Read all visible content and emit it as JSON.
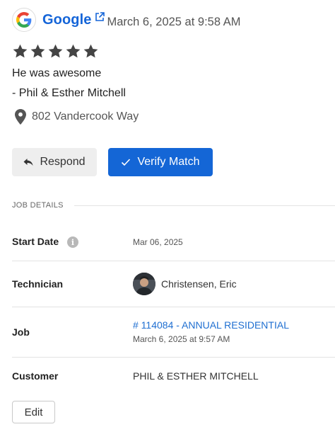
{
  "review": {
    "source": "Google",
    "source_icon": "google-g-logo",
    "date": "March 6, 2025 at 9:58 AM",
    "rating": 5,
    "text": "He was awesome",
    "reviewer": "- Phil & Esther Mitchell",
    "address": "802 Vandercook Way"
  },
  "actions": {
    "respond_label": "Respond",
    "verify_label": "Verify Match"
  },
  "job_details": {
    "section_label": "JOB DETAILS",
    "start_date": {
      "label": "Start Date",
      "value": "Mar 06, 2025"
    },
    "technician": {
      "label": "Technician",
      "value": "Christensen, Eric"
    },
    "job": {
      "label": "Job",
      "link": "# 114084 - ANNUAL RESIDENTIAL",
      "date": "March 6, 2025 at 9:57 AM"
    },
    "customer": {
      "label": "Customer",
      "value": "PHIL & ESTHER MITCHELL"
    },
    "edit_label": "Edit"
  },
  "colors": {
    "brand_blue": "#1466d6",
    "link_blue": "#1f6fd1",
    "star_gray": "#444444"
  }
}
